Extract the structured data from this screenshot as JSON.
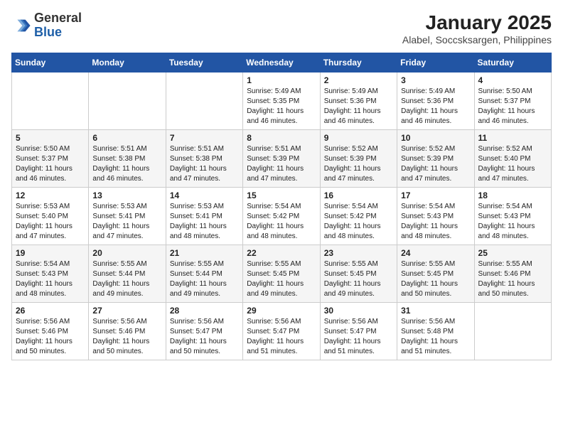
{
  "logo": {
    "general": "General",
    "blue": "Blue"
  },
  "title": "January 2025",
  "subtitle": "Alabel, Soccsksargen, Philippines",
  "days_of_week": [
    "Sunday",
    "Monday",
    "Tuesday",
    "Wednesday",
    "Thursday",
    "Friday",
    "Saturday"
  ],
  "weeks": [
    [
      {
        "day": "",
        "info": ""
      },
      {
        "day": "",
        "info": ""
      },
      {
        "day": "",
        "info": ""
      },
      {
        "day": "1",
        "info": "Sunrise: 5:49 AM\nSunset: 5:35 PM\nDaylight: 11 hours and 46 minutes."
      },
      {
        "day": "2",
        "info": "Sunrise: 5:49 AM\nSunset: 5:36 PM\nDaylight: 11 hours and 46 minutes."
      },
      {
        "day": "3",
        "info": "Sunrise: 5:49 AM\nSunset: 5:36 PM\nDaylight: 11 hours and 46 minutes."
      },
      {
        "day": "4",
        "info": "Sunrise: 5:50 AM\nSunset: 5:37 PM\nDaylight: 11 hours and 46 minutes."
      }
    ],
    [
      {
        "day": "5",
        "info": "Sunrise: 5:50 AM\nSunset: 5:37 PM\nDaylight: 11 hours and 46 minutes."
      },
      {
        "day": "6",
        "info": "Sunrise: 5:51 AM\nSunset: 5:38 PM\nDaylight: 11 hours and 46 minutes."
      },
      {
        "day": "7",
        "info": "Sunrise: 5:51 AM\nSunset: 5:38 PM\nDaylight: 11 hours and 47 minutes."
      },
      {
        "day": "8",
        "info": "Sunrise: 5:51 AM\nSunset: 5:39 PM\nDaylight: 11 hours and 47 minutes."
      },
      {
        "day": "9",
        "info": "Sunrise: 5:52 AM\nSunset: 5:39 PM\nDaylight: 11 hours and 47 minutes."
      },
      {
        "day": "10",
        "info": "Sunrise: 5:52 AM\nSunset: 5:39 PM\nDaylight: 11 hours and 47 minutes."
      },
      {
        "day": "11",
        "info": "Sunrise: 5:52 AM\nSunset: 5:40 PM\nDaylight: 11 hours and 47 minutes."
      }
    ],
    [
      {
        "day": "12",
        "info": "Sunrise: 5:53 AM\nSunset: 5:40 PM\nDaylight: 11 hours and 47 minutes."
      },
      {
        "day": "13",
        "info": "Sunrise: 5:53 AM\nSunset: 5:41 PM\nDaylight: 11 hours and 47 minutes."
      },
      {
        "day": "14",
        "info": "Sunrise: 5:53 AM\nSunset: 5:41 PM\nDaylight: 11 hours and 48 minutes."
      },
      {
        "day": "15",
        "info": "Sunrise: 5:54 AM\nSunset: 5:42 PM\nDaylight: 11 hours and 48 minutes."
      },
      {
        "day": "16",
        "info": "Sunrise: 5:54 AM\nSunset: 5:42 PM\nDaylight: 11 hours and 48 minutes."
      },
      {
        "day": "17",
        "info": "Sunrise: 5:54 AM\nSunset: 5:43 PM\nDaylight: 11 hours and 48 minutes."
      },
      {
        "day": "18",
        "info": "Sunrise: 5:54 AM\nSunset: 5:43 PM\nDaylight: 11 hours and 48 minutes."
      }
    ],
    [
      {
        "day": "19",
        "info": "Sunrise: 5:54 AM\nSunset: 5:43 PM\nDaylight: 11 hours and 48 minutes."
      },
      {
        "day": "20",
        "info": "Sunrise: 5:55 AM\nSunset: 5:44 PM\nDaylight: 11 hours and 49 minutes."
      },
      {
        "day": "21",
        "info": "Sunrise: 5:55 AM\nSunset: 5:44 PM\nDaylight: 11 hours and 49 minutes."
      },
      {
        "day": "22",
        "info": "Sunrise: 5:55 AM\nSunset: 5:45 PM\nDaylight: 11 hours and 49 minutes."
      },
      {
        "day": "23",
        "info": "Sunrise: 5:55 AM\nSunset: 5:45 PM\nDaylight: 11 hours and 49 minutes."
      },
      {
        "day": "24",
        "info": "Sunrise: 5:55 AM\nSunset: 5:45 PM\nDaylight: 11 hours and 50 minutes."
      },
      {
        "day": "25",
        "info": "Sunrise: 5:55 AM\nSunset: 5:46 PM\nDaylight: 11 hours and 50 minutes."
      }
    ],
    [
      {
        "day": "26",
        "info": "Sunrise: 5:56 AM\nSunset: 5:46 PM\nDaylight: 11 hours and 50 minutes."
      },
      {
        "day": "27",
        "info": "Sunrise: 5:56 AM\nSunset: 5:46 PM\nDaylight: 11 hours and 50 minutes."
      },
      {
        "day": "28",
        "info": "Sunrise: 5:56 AM\nSunset: 5:47 PM\nDaylight: 11 hours and 50 minutes."
      },
      {
        "day": "29",
        "info": "Sunrise: 5:56 AM\nSunset: 5:47 PM\nDaylight: 11 hours and 51 minutes."
      },
      {
        "day": "30",
        "info": "Sunrise: 5:56 AM\nSunset: 5:47 PM\nDaylight: 11 hours and 51 minutes."
      },
      {
        "day": "31",
        "info": "Sunrise: 5:56 AM\nSunset: 5:48 PM\nDaylight: 11 hours and 51 minutes."
      },
      {
        "day": "",
        "info": ""
      }
    ]
  ]
}
